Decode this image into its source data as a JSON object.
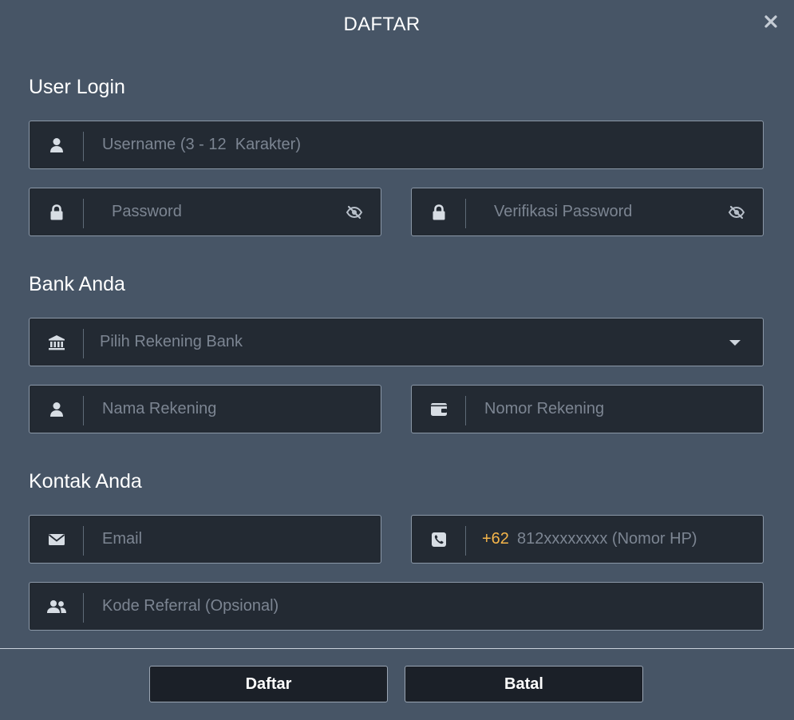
{
  "modal": {
    "title": "DAFTAR"
  },
  "sections": {
    "user_login": "User Login",
    "bank": "Bank Anda",
    "contact": "Kontak Anda"
  },
  "fields": {
    "username": {
      "placeholder": "Username (3 - 12  Karakter)",
      "value": "",
      "icon": "user-icon"
    },
    "password": {
      "placeholder": "Password",
      "value": "",
      "icon": "lock-icon"
    },
    "verify_password": {
      "placeholder": "Verifikasi Password",
      "value": "",
      "icon": "lock-icon"
    },
    "bank_select": {
      "selected": "Pilih Rekening Bank",
      "icon": "bank-icon"
    },
    "account_name": {
      "placeholder": "Nama Rekening",
      "value": "",
      "icon": "user-icon"
    },
    "account_number": {
      "placeholder": "Nomor Rekening",
      "value": "",
      "icon": "wallet-icon"
    },
    "email": {
      "placeholder": "Email",
      "value": "",
      "icon": "envelope-icon"
    },
    "phone": {
      "prefix": "+62",
      "placeholder": "812xxxxxxxx (Nomor HP)",
      "value": "",
      "icon": "phone-icon"
    },
    "referral": {
      "placeholder": "Kode Referral (Opsional)",
      "value": "",
      "icon": "users-icon"
    }
  },
  "buttons": {
    "submit": "Daftar",
    "cancel": "Batal"
  },
  "colors": {
    "background": "#475566",
    "field_bg": "#232a33",
    "accent_prefix": "#f5b54a"
  }
}
